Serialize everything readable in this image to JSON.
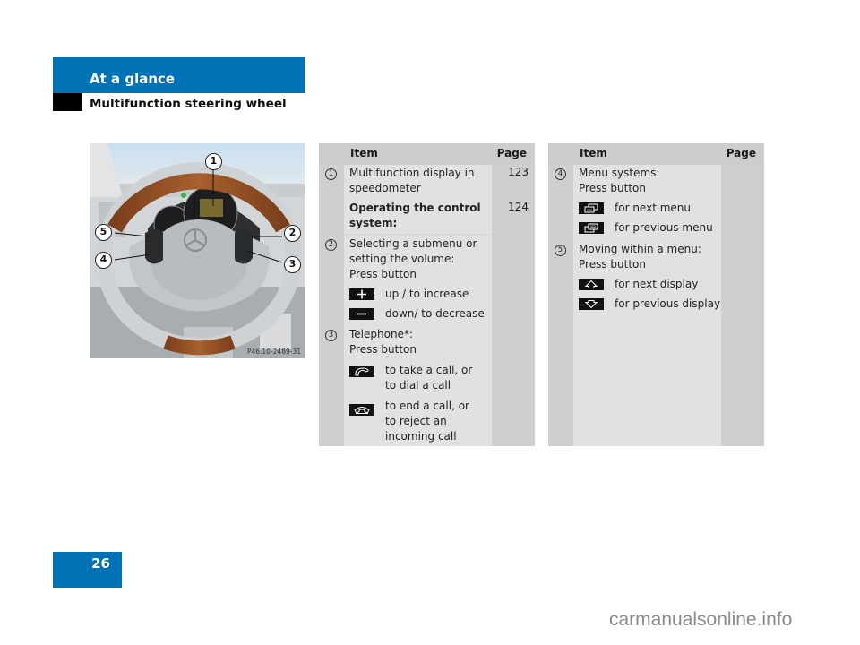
{
  "header": {
    "section": "At a glance",
    "subsection": "Multifunction steering wheel"
  },
  "figure": {
    "code": "P46.10-2489-31",
    "callouts": [
      "1",
      "2",
      "3",
      "4",
      "5"
    ]
  },
  "table_left": {
    "headers": {
      "item": "Item",
      "page": "Page"
    },
    "rows": [
      {
        "num": "1",
        "text": "Multifunction display in\nspeedometer",
        "page": "123"
      },
      {
        "num": "",
        "text": "Operating the control\nsystem:",
        "bold": true,
        "page": "124"
      },
      {
        "num": "2",
        "text": "Selecting a submenu or\nsetting the volume:\nPress button",
        "page": ""
      },
      {
        "symbol": "plus-icon",
        "text": "up / to increase"
      },
      {
        "symbol": "minus-icon",
        "text": "down/ to decrease"
      },
      {
        "num": "3",
        "text": "Telephone*:\nPress button",
        "page": ""
      },
      {
        "symbol": "phone-pickup-icon",
        "text": "to take a call, or\nto dial a call"
      },
      {
        "symbol": "phone-hangup-icon",
        "text": "to end a call, or\nto reject an\nincoming call"
      }
    ]
  },
  "table_right": {
    "headers": {
      "item": "Item",
      "page": "Page"
    },
    "rows": [
      {
        "num": "4",
        "text": "Menu systems:\nPress button",
        "page": ""
      },
      {
        "symbol": "next-menu-icon",
        "text": "for next menu"
      },
      {
        "symbol": "previous-menu-icon",
        "text": "for previous menu"
      },
      {
        "num": "5",
        "text": "Moving within a menu:\nPress button",
        "page": ""
      },
      {
        "symbol": "arrow-up-icon",
        "text": "for next display"
      },
      {
        "symbol": "arrow-down-icon",
        "text": "for previous display"
      }
    ]
  },
  "footer": {
    "page_number": "26",
    "watermark": "carmanualsonline.info"
  },
  "colors": {
    "brand_blue": "#0072b5",
    "table_bg": "#e1e1e1",
    "table_side_col": "#cfcfcf"
  }
}
